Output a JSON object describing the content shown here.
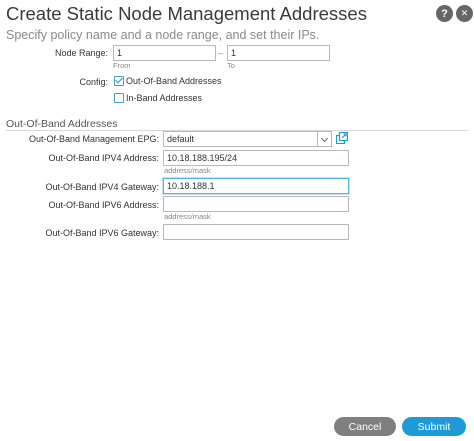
{
  "header": {
    "title": "Create Static Node Management Addresses",
    "subtitle": "Specify policy name and a node range, and set their IPs.",
    "help_label": "?",
    "close_label": "✕"
  },
  "node_range": {
    "label": "Node Range:",
    "from_value": "1",
    "from_hint": "From",
    "separator": "–",
    "to_value": "1",
    "to_hint": "To"
  },
  "config": {
    "label": "Config:",
    "options": [
      {
        "label": "Out-Of-Band Addresses",
        "checked": true
      },
      {
        "label": "In-Band Addresses",
        "checked": false
      }
    ]
  },
  "oob": {
    "section_title": "Out-Of-Band Addresses",
    "epg_label": "Out-Of-Band Management EPG:",
    "epg_value": "default",
    "ipv4_address_label": "Out-Of-Band IPV4 Address:",
    "ipv4_address_value": "10.18.188.195/24",
    "ipv4_address_hint": "address/mask",
    "ipv4_gateway_label": "Out-Of-Band IPV4 Gateway:",
    "ipv4_gateway_value": "10.18.188.1",
    "ipv6_address_label": "Out-Of-Band IPV6 Address:",
    "ipv6_address_value": "",
    "ipv6_address_hint": "address/mask",
    "ipv6_gateway_label": "Out-Of-Band IPV6 Gateway:",
    "ipv6_gateway_value": ""
  },
  "footer": {
    "cancel_label": "Cancel",
    "submit_label": "Submit"
  },
  "colors": {
    "accent": "#1e9bd7",
    "cancel": "#7f7f7f",
    "focus_border": "#5ab3d8"
  },
  "icons": [
    "help-icon",
    "close-icon",
    "chevron-down-icon",
    "link-icon",
    "checkmark-icon"
  ]
}
